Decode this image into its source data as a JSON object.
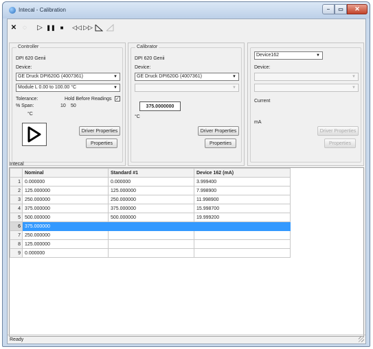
{
  "window": {
    "title": "Intecal - Calibration",
    "minimize_glyph": "–",
    "maximize_glyph": "▭",
    "close_glyph": "✕"
  },
  "toolbar": {
    "icons": [
      "stop-icon",
      "refresh-icon",
      "play-icon",
      "pause-icon",
      "stop-square-icon",
      "rewind-icon",
      "fast-forward-icon",
      "ramp-down-icon",
      "ramp-up-icon"
    ]
  },
  "controller": {
    "group_title": "Controller",
    "model": "DPI 620 Genii",
    "device_label": "Device:",
    "device_value": "GE Druck DPI620G (4007361)",
    "module_value": "Module  L  0.00 to  100.00 °C",
    "tolerance_label": "Tolerance:",
    "hold_label": "Hold Before Readings",
    "hold_checked": "✓",
    "span_label": "% Span:",
    "span_a": "10",
    "span_b": "50",
    "unit": "°C",
    "driver_properties": "Driver Properties",
    "properties": "Properties"
  },
  "calibrator": {
    "group_title": "Calibrator",
    "model": "DPI 620 Genii",
    "device_label": "Device:",
    "device_value": "GE Druck DPI620G (4007361)",
    "reading": "375.0000000",
    "unit": "°C",
    "driver_properties": "Driver Properties",
    "properties": "Properties"
  },
  "device": {
    "selector_value": "Device162",
    "device_label": "Device:",
    "mode": "Current",
    "unit": "mA",
    "driver_properties": "Driver Properties",
    "properties": "Properties"
  },
  "grid": {
    "label": "Intecal",
    "columns": [
      "Nominal",
      "Standard #1",
      "Device 162 (mA)"
    ],
    "rows": [
      {
        "n": "1",
        "nominal": "0.000000",
        "standard": "0.000000",
        "device": "3.999400"
      },
      {
        "n": "2",
        "nominal": "125.000000",
        "standard": "125.000000",
        "device": "7.998900"
      },
      {
        "n": "3",
        "nominal": "250.000000",
        "standard": "250.000000",
        "device": "11.998900"
      },
      {
        "n": "4",
        "nominal": "375.000000",
        "standard": "375.000000",
        "device": "15.998700"
      },
      {
        "n": "5",
        "nominal": "500.000000",
        "standard": "500.000000",
        "device": "19.999200"
      },
      {
        "n": "6",
        "nominal": "375.000000",
        "standard": "",
        "device": ""
      },
      {
        "n": "7",
        "nominal": "250.000000",
        "standard": "",
        "device": ""
      },
      {
        "n": "8",
        "nominal": "125.000000",
        "standard": "",
        "device": ""
      },
      {
        "n": "9",
        "nominal": "0.000000",
        "standard": "",
        "device": ""
      }
    ],
    "selected_row": "6"
  },
  "status": {
    "text": "Ready"
  },
  "colors": {
    "selection": "#3399ff",
    "window_frame": "#c9d9ec",
    "close_button": "#c2432a"
  }
}
